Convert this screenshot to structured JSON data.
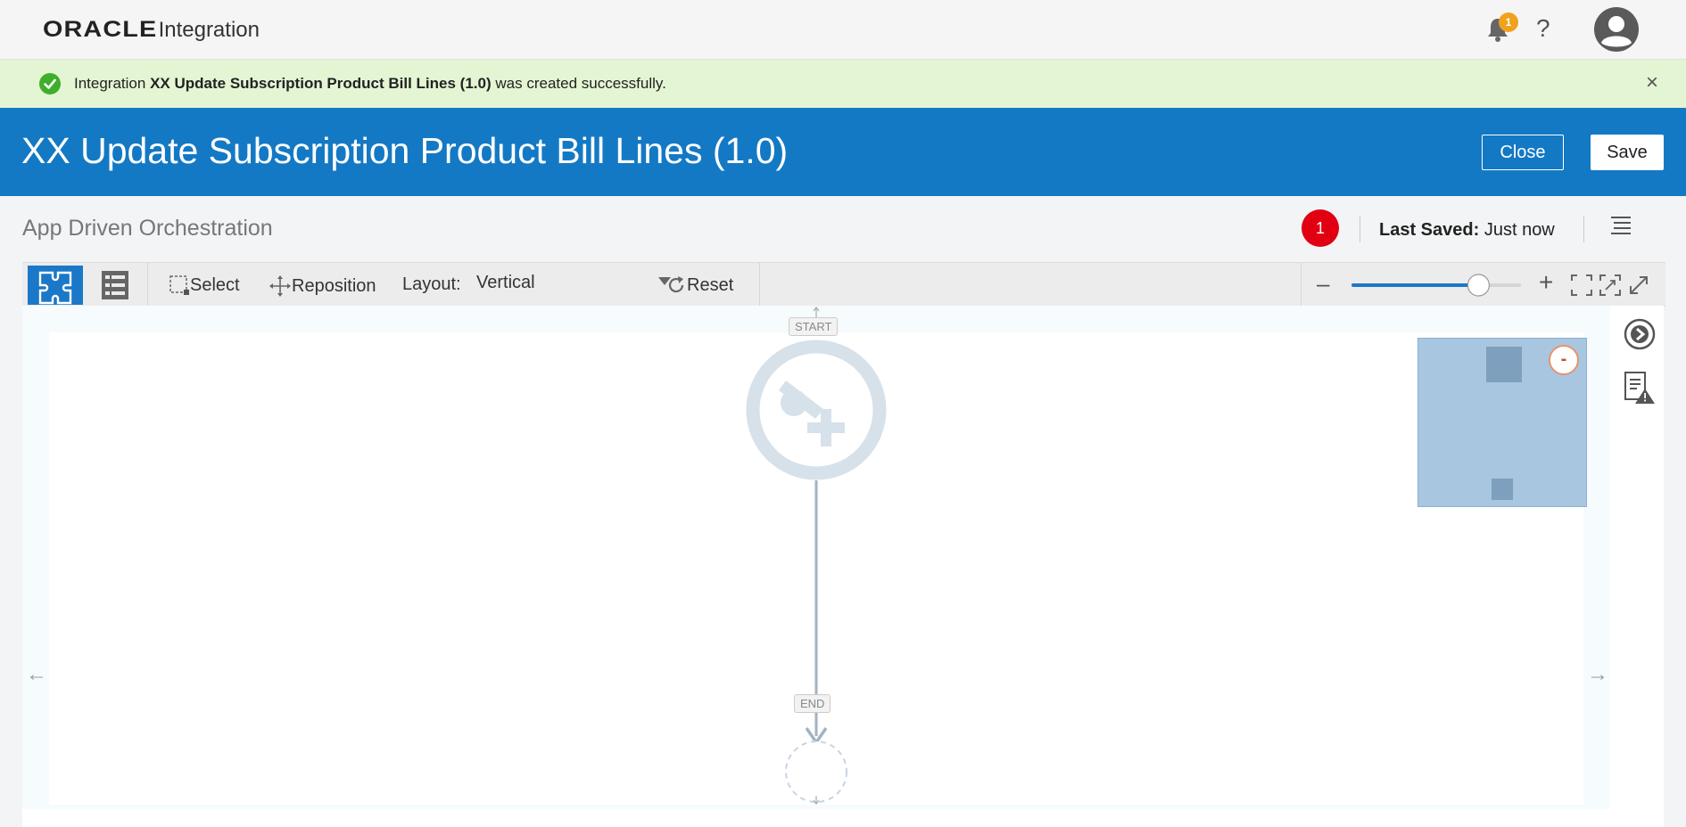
{
  "topbar": {
    "brand": "ORACLE",
    "product": "Integration",
    "notification_count": "1",
    "help_label": "?"
  },
  "banner": {
    "prefix": "Integration",
    "integration_name": "XX Update Subscription Product Bill Lines (1.0)",
    "suffix": "was created successfully.",
    "close_label": "×"
  },
  "header": {
    "title": "XX Update Subscription Product Bill Lines (1.0)",
    "close_label": "Close",
    "save_label": "Save"
  },
  "subheader": {
    "title": "App Driven Orchestration",
    "error_count": "1",
    "last_saved_label": "Last Saved:",
    "last_saved_value": "Just now"
  },
  "toolbar": {
    "select_label": "Select",
    "reposition_label": "Reposition",
    "layout_label": "Layout:",
    "layout_value": "Vertical",
    "reset_label": "Reset",
    "zoom_level": 0.8
  },
  "canvas": {
    "start_label": "START",
    "end_label": "END",
    "left_arrow": "←",
    "right_arrow": "→",
    "minimap_collapse": "-"
  },
  "colors": {
    "header_blue": "#1479c4",
    "banner_green": "#e4f5d3",
    "error_red": "#e00012",
    "badge_orange": "#f0a21c"
  }
}
